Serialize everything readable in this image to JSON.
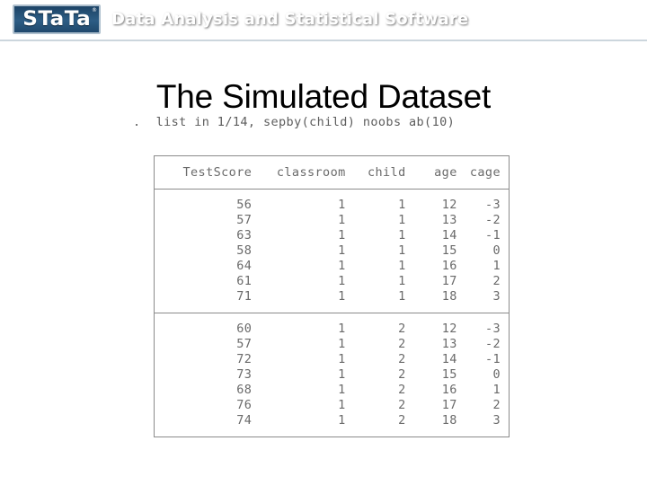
{
  "banner": {
    "logo_text": "STaTa",
    "logo_trademark": "®",
    "tagline": "Data Analysis and Statistical Software",
    "gradient_top": "#0d2b4e",
    "gradient_bottom": "#c9d3da"
  },
  "slide": {
    "title": "The Simulated Dataset"
  },
  "stata": {
    "command": ".  list in 1/14, sepby(child) noobs ab(10)",
    "table": {
      "headers": [
        "TestScore",
        "classroom",
        "child",
        "age",
        "cage"
      ],
      "blocks": [
        {
          "rows": [
            [
              "56",
              "1",
              "1",
              "12",
              "-3"
            ],
            [
              "57",
              "1",
              "1",
              "13",
              "-2"
            ],
            [
              "63",
              "1",
              "1",
              "14",
              "-1"
            ],
            [
              "58",
              "1",
              "1",
              "15",
              "0"
            ],
            [
              "64",
              "1",
              "1",
              "16",
              "1"
            ],
            [
              "61",
              "1",
              "1",
              "17",
              "2"
            ],
            [
              "71",
              "1",
              "1",
              "18",
              "3"
            ]
          ]
        },
        {
          "rows": [
            [
              "60",
              "1",
              "2",
              "12",
              "-3"
            ],
            [
              "57",
              "1",
              "2",
              "13",
              "-2"
            ],
            [
              "72",
              "1",
              "2",
              "14",
              "-1"
            ],
            [
              "73",
              "1",
              "2",
              "15",
              "0"
            ],
            [
              "68",
              "1",
              "2",
              "16",
              "1"
            ],
            [
              "76",
              "1",
              "2",
              "17",
              "2"
            ],
            [
              "74",
              "1",
              "2",
              "18",
              "3"
            ]
          ]
        }
      ]
    }
  },
  "colors": {
    "text_gray": "#6a6a6a",
    "border_gray": "#8b8b8b",
    "title_black": "#000000",
    "banner_white": "#ffffff"
  }
}
